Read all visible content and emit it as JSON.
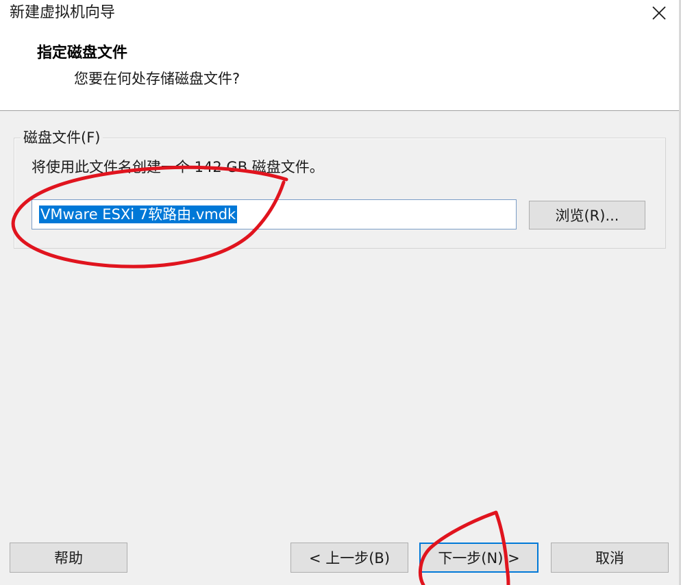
{
  "window": {
    "title": "新建虚拟机向导",
    "close_glyph": "✕"
  },
  "header": {
    "title": "指定磁盘文件",
    "subtitle": "您要在何处存储磁盘文件?"
  },
  "disk_file_group": {
    "legend": "磁盘文件(F)",
    "description": "将使用此文件名创建一个 142 GB 磁盘文件。",
    "filename_value": "VMware ESXi 7软路由.vmdk",
    "browse_label": "浏览(R)..."
  },
  "footer": {
    "help_label": "帮助",
    "back_label": "< 上一步(B)",
    "next_label": "下一步(N) >",
    "cancel_label": "取消"
  },
  "colors": {
    "selection": "#0078d7",
    "annotation_red": "#e0141e",
    "dialog_bg": "#f0f0f0"
  },
  "icons": {
    "close": "close-icon"
  }
}
